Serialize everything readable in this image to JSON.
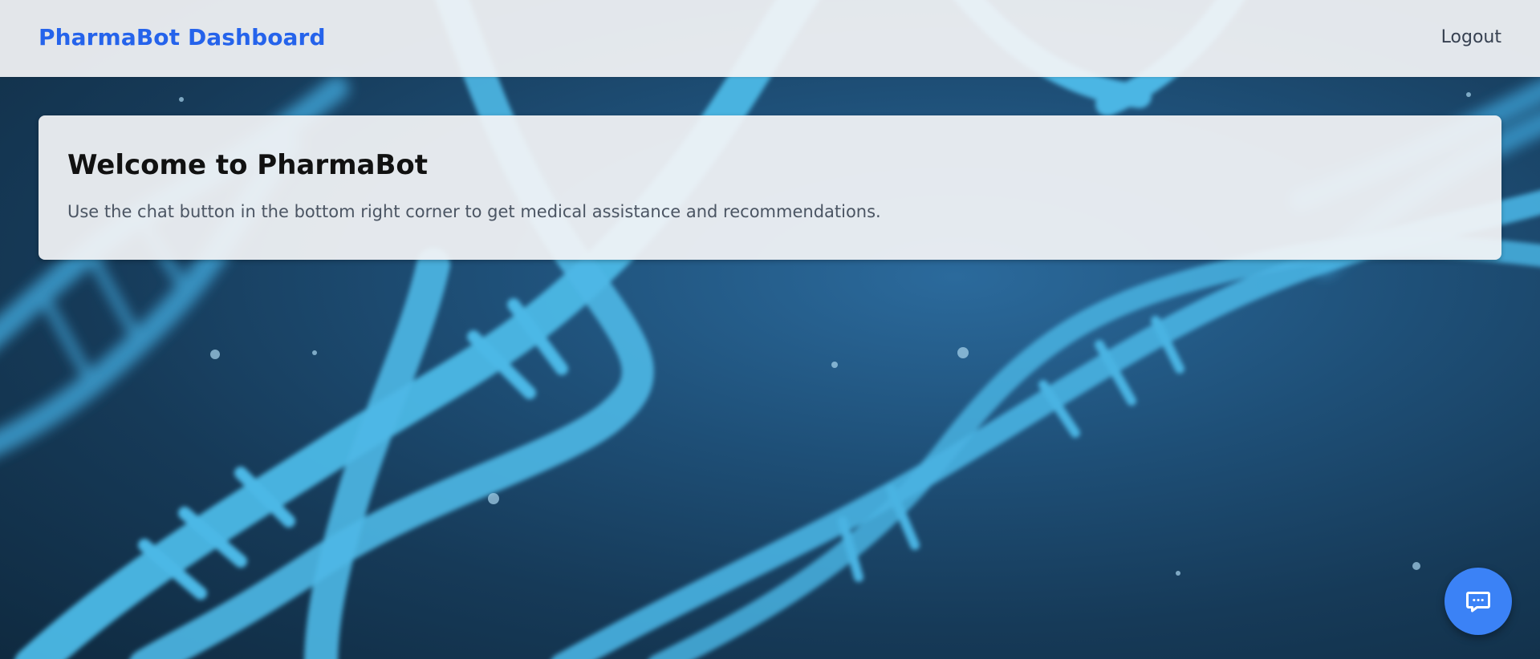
{
  "header": {
    "brand": "PharmaBot Dashboard",
    "logout_label": "Logout"
  },
  "welcome": {
    "title": "Welcome to PharmaBot",
    "text": "Use the chat button in the bottom right corner to get medical assistance and recommendations."
  },
  "chat_button": {
    "icon": "chat-bubble-icon",
    "color": "#3b82f6"
  },
  "background": {
    "image": "dna-double-helix",
    "colors": {
      "base": "#163a58",
      "strand": "#4cb8e6"
    }
  },
  "colors": {
    "brand": "#2563eb",
    "panel": "#f3f4f6",
    "text_muted": "#4b5563"
  }
}
